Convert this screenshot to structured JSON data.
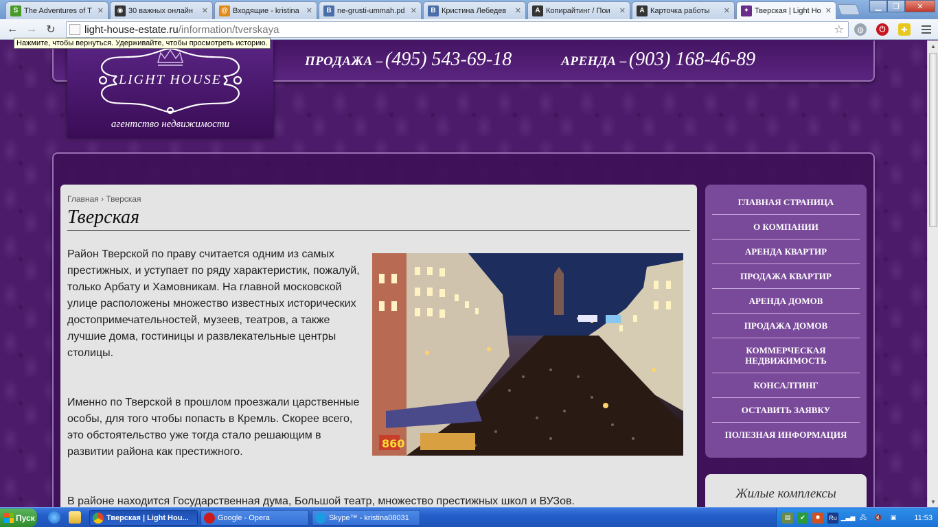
{
  "browser": {
    "tabs": [
      {
        "title": "The Adventures of T",
        "favicon": "S",
        "color": "#4a9a2a"
      },
      {
        "title": "30 важных онлайн",
        "favicon": "◉",
        "color": "#333333"
      },
      {
        "title": "Входящие - kristina",
        "favicon": "@",
        "color": "#e08a1a"
      },
      {
        "title": "ne-grusti-ummah.pd",
        "favicon": "B",
        "color": "#4a6ea8"
      },
      {
        "title": "Кристина Лебедев",
        "favicon": "B",
        "color": "#4a6ea8"
      },
      {
        "title": "Копирайтинг / Пои",
        "favicon": "A",
        "color": "#333333"
      },
      {
        "title": "Карточка работы",
        "favicon": "A",
        "color": "#333333"
      },
      {
        "title": "Тверская | Light Ho",
        "favicon": "✦",
        "color": "#6a2c8a"
      }
    ],
    "url_domain": "light-house-estate.ru",
    "url_path": "/information/tverskaya",
    "back_tooltip": "Нажмите, чтобы вернуться. Удерживайте, чтобы просмотреть историю."
  },
  "site": {
    "logo_brand": "LIGHT HOUSE",
    "logo_tagline": "агентство недвижимости",
    "phones": [
      {
        "label": "ПРОДАЖА –",
        "number": "(495) 543-69-18"
      },
      {
        "label": "АРЕНДА –",
        "number": "(903) 168-46-89"
      }
    ],
    "breadcrumb_home": "Главная",
    "breadcrumb_sep": "›",
    "breadcrumb_current": "Тверская",
    "title": "Тверская",
    "paragraphs": [
      "Район Тверской по праву считается одним из самых престижных, и уступает по ряду характеристик, пожалуй, только Арбату и Хамовникам. На главной московской улице расположены множество известных исторических достопримечательностей, музеев, театров, а также лучшие дома, гостиницы и развлекательные центры столицы.",
      "Именно по Тверской в прошлом проезжали царственные особы, для того чтобы попасть в Кремль. Скорее всего, это обстоятельство уже тогда стало решающим в развитии района как престижного.",
      "В районе находится Государственная дума, Большой театр, множество престижных школ и ВУЗов."
    ],
    "photo_signs": {
      "a": "860"
    },
    "menu": [
      {
        "label": "ГЛАВНАЯ СТРАНИЦА"
      },
      {
        "label": "О КОМПАНИИ"
      },
      {
        "label": "АРЕНДА КВАРТИР"
      },
      {
        "label": "ПРОДАЖА КВАРТИР"
      },
      {
        "label": "АРЕНДА ДОМОВ"
      },
      {
        "label": "ПРОДАЖА ДОМОВ"
      },
      {
        "label": "КОММЕРЧЕСКАЯ НЕДВИЖИМОСТЬ"
      },
      {
        "label": "КОНСАЛТИНГ"
      },
      {
        "label": "ОСТАВИТЬ ЗАЯВКУ"
      },
      {
        "label": "ПОЛЕЗНАЯ ИНФОРМАЦИЯ"
      }
    ],
    "sidebar_block_title": "Жилые комплексы"
  },
  "taskbar": {
    "start_label": "Пуск",
    "tasks": [
      {
        "label": "Тверская | Light Hou...",
        "color": "#e0452a"
      },
      {
        "label": "Google - Opera",
        "color": "#cc1b1b"
      },
      {
        "label": "Skype™ - kristina08031",
        "color": "#1a9ce0"
      }
    ],
    "lang": "Ru",
    "clock": "11:53"
  }
}
